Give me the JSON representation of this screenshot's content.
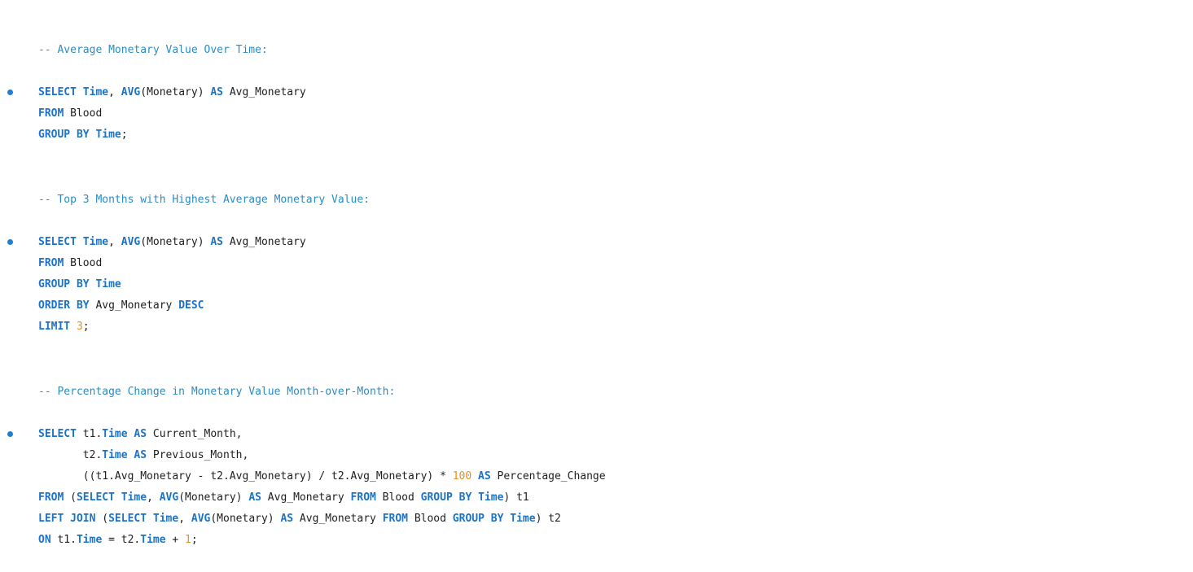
{
  "colors": {
    "keyword": "#1a73c9",
    "comment": "#2b8cc4",
    "number": "#e6911b",
    "text": "#1e1e1e",
    "bullet": "#1f7fd0"
  },
  "blocks": [
    {
      "comment": "-- Average Monetary Value Over Time:",
      "lines": [
        [
          {
            "t": "kw",
            "v": "SELECT "
          },
          {
            "t": "kw",
            "v": "Time"
          },
          {
            "t": "tx",
            "v": ", "
          },
          {
            "t": "kw",
            "v": "AVG"
          },
          {
            "t": "tx",
            "v": "(Monetary) "
          },
          {
            "t": "kw",
            "v": "AS"
          },
          {
            "t": "tx",
            "v": " Avg_Monetary"
          }
        ],
        [
          {
            "t": "kw",
            "v": "FROM"
          },
          {
            "t": "tx",
            "v": " Blood"
          }
        ],
        [
          {
            "t": "kw",
            "v": "GROUP BY "
          },
          {
            "t": "kw",
            "v": "Time"
          },
          {
            "t": "tx",
            "v": ";"
          }
        ]
      ]
    },
    {
      "comment": "-- Top 3 Months with Highest Average Monetary Value:",
      "lines": [
        [
          {
            "t": "kw",
            "v": "SELECT "
          },
          {
            "t": "kw",
            "v": "Time"
          },
          {
            "t": "tx",
            "v": ", "
          },
          {
            "t": "kw",
            "v": "AVG"
          },
          {
            "t": "tx",
            "v": "(Monetary) "
          },
          {
            "t": "kw",
            "v": "AS"
          },
          {
            "t": "tx",
            "v": " Avg_Monetary"
          }
        ],
        [
          {
            "t": "kw",
            "v": "FROM"
          },
          {
            "t": "tx",
            "v": " Blood"
          }
        ],
        [
          {
            "t": "kw",
            "v": "GROUP BY "
          },
          {
            "t": "kw",
            "v": "Time"
          }
        ],
        [
          {
            "t": "kw",
            "v": "ORDER BY"
          },
          {
            "t": "tx",
            "v": " Avg_Monetary "
          },
          {
            "t": "kw",
            "v": "DESC"
          }
        ],
        [
          {
            "t": "kw",
            "v": "LIMIT "
          },
          {
            "t": "num",
            "v": "3"
          },
          {
            "t": "tx",
            "v": ";"
          }
        ]
      ]
    },
    {
      "comment": "-- Percentage Change in Monetary Value Month-over-Month:",
      "lines": [
        [
          {
            "t": "kw",
            "v": "SELECT"
          },
          {
            "t": "tx",
            "v": " t1."
          },
          {
            "t": "kw",
            "v": "Time"
          },
          {
            "t": "tx",
            "v": " "
          },
          {
            "t": "kw",
            "v": "AS"
          },
          {
            "t": "tx",
            "v": " Current_Month,"
          }
        ],
        [
          {
            "t": "tx",
            "v": "       t2."
          },
          {
            "t": "kw",
            "v": "Time"
          },
          {
            "t": "tx",
            "v": " "
          },
          {
            "t": "kw",
            "v": "AS"
          },
          {
            "t": "tx",
            "v": " Previous_Month,"
          }
        ],
        [
          {
            "t": "tx",
            "v": "       ((t1.Avg_Monetary - t2.Avg_Monetary) / t2.Avg_Monetary) * "
          },
          {
            "t": "num",
            "v": "100"
          },
          {
            "t": "tx",
            "v": " "
          },
          {
            "t": "kw",
            "v": "AS"
          },
          {
            "t": "tx",
            "v": " Percentage_Change"
          }
        ],
        [
          {
            "t": "kw",
            "v": "FROM"
          },
          {
            "t": "tx",
            "v": " ("
          },
          {
            "t": "kw",
            "v": "SELECT "
          },
          {
            "t": "kw",
            "v": "Time"
          },
          {
            "t": "tx",
            "v": ", "
          },
          {
            "t": "kw",
            "v": "AVG"
          },
          {
            "t": "tx",
            "v": "(Monetary) "
          },
          {
            "t": "kw",
            "v": "AS"
          },
          {
            "t": "tx",
            "v": " Avg_Monetary "
          },
          {
            "t": "kw",
            "v": "FROM"
          },
          {
            "t": "tx",
            "v": " Blood "
          },
          {
            "t": "kw",
            "v": "GROUP BY "
          },
          {
            "t": "kw",
            "v": "Time"
          },
          {
            "t": "tx",
            "v": ") t1"
          }
        ],
        [
          {
            "t": "kw",
            "v": "LEFT JOIN"
          },
          {
            "t": "tx",
            "v": " ("
          },
          {
            "t": "kw",
            "v": "SELECT "
          },
          {
            "t": "kw",
            "v": "Time"
          },
          {
            "t": "tx",
            "v": ", "
          },
          {
            "t": "kw",
            "v": "AVG"
          },
          {
            "t": "tx",
            "v": "(Monetary) "
          },
          {
            "t": "kw",
            "v": "AS"
          },
          {
            "t": "tx",
            "v": " Avg_Monetary "
          },
          {
            "t": "kw",
            "v": "FROM"
          },
          {
            "t": "tx",
            "v": " Blood "
          },
          {
            "t": "kw",
            "v": "GROUP BY "
          },
          {
            "t": "kw",
            "v": "Time"
          },
          {
            "t": "tx",
            "v": ") t2"
          }
        ],
        [
          {
            "t": "kw",
            "v": "ON"
          },
          {
            "t": "tx",
            "v": " t1."
          },
          {
            "t": "kw",
            "v": "Time"
          },
          {
            "t": "tx",
            "v": " = t2."
          },
          {
            "t": "kw",
            "v": "Time"
          },
          {
            "t": "tx",
            "v": " + "
          },
          {
            "t": "num",
            "v": "1"
          },
          {
            "t": "tx",
            "v": ";"
          }
        ]
      ]
    }
  ]
}
